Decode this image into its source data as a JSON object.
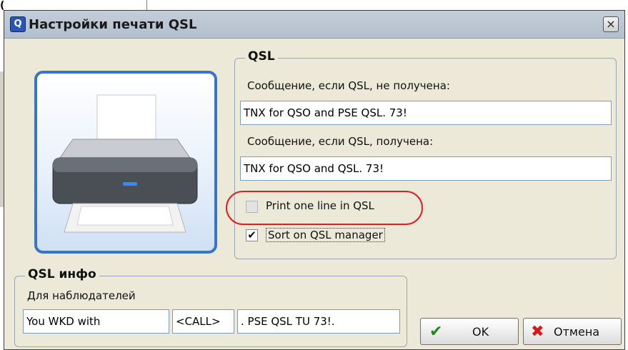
{
  "background": {
    "fragment": "("
  },
  "window": {
    "title": "Настройки печати QSL",
    "app_icon_glyph": "Q",
    "close_glyph": "×"
  },
  "qsl_group": {
    "title": "QSL",
    "msg_not_received_label": "Сообщение, если QSL, не получена:",
    "msg_not_received_value": "TNX for QSO and PSE QSL. 73!",
    "msg_received_label": "Сообщение, если QSL, получена:",
    "msg_received_value": "TNX for QSO and QSL. 73!",
    "print_one_line_label": "Print one line in QSL",
    "print_one_line_checked": false,
    "sort_manager_label": "Sort on QSL manager",
    "sort_manager_checked": true,
    "check_glyph": "✔"
  },
  "info_group": {
    "title": "QSL инфо",
    "subtitle": "Для наблюдателей",
    "field1": "You WKD with",
    "field2": "<CALL>",
    "field3": ". PSE QSL TU 73!."
  },
  "buttons": {
    "ok_label": "OK",
    "ok_icon": "✔",
    "cancel_label": "Отмена",
    "cancel_icon": "✖"
  },
  "colors": {
    "ok_icon": "#1e8a1e",
    "cancel_icon": "#d81818",
    "highlight_ring": "#e02020"
  }
}
